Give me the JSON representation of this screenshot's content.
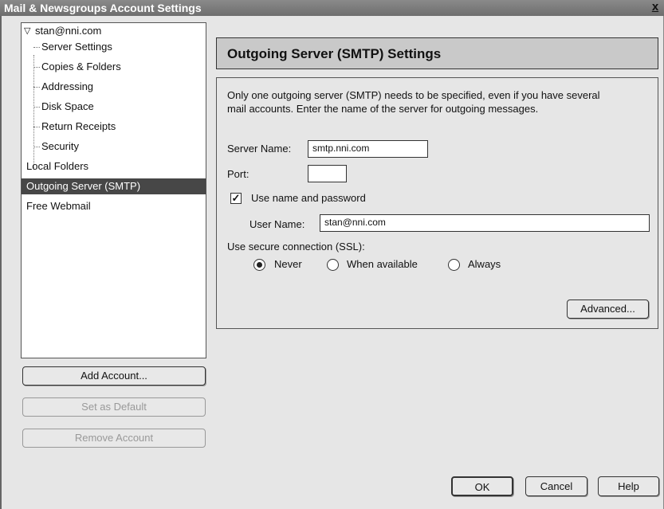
{
  "window": {
    "title": "Mail & Newsgroups Account Settings",
    "close": "x"
  },
  "tree": {
    "account": "stan@nni.com",
    "children": [
      "Server Settings",
      "Copies & Folders",
      "Addressing",
      "Disk Space",
      "Return Receipts",
      "Security"
    ],
    "local_folders": "Local Folders",
    "outgoing": "Outgoing Server (SMTP)",
    "webmail": "Free Webmail"
  },
  "buttons": {
    "add_account": "Add Account...",
    "set_default": "Set as Default",
    "remove_account": "Remove Account",
    "advanced": "Advanced...",
    "ok": "OK",
    "cancel": "Cancel",
    "help": "Help"
  },
  "panel": {
    "title": "Outgoing Server (SMTP) Settings",
    "description_line1": "Only one outgoing server (SMTP) needs to be specified, even if you have several",
    "description_line2": "mail accounts. Enter the name of the server for outgoing messages.",
    "server_name_label": "Server Name:",
    "server_name_value": "smtp.nni.com",
    "port_label": "Port:",
    "port_value": "",
    "use_auth_label": "Use name and password",
    "use_auth_checked": true,
    "user_name_label": "User Name:",
    "user_name_value": "stan@nni.com",
    "ssl_label": "Use secure connection (SSL):",
    "ssl_options": [
      "Never",
      "When available",
      "Always"
    ],
    "ssl_selected": "Never"
  }
}
